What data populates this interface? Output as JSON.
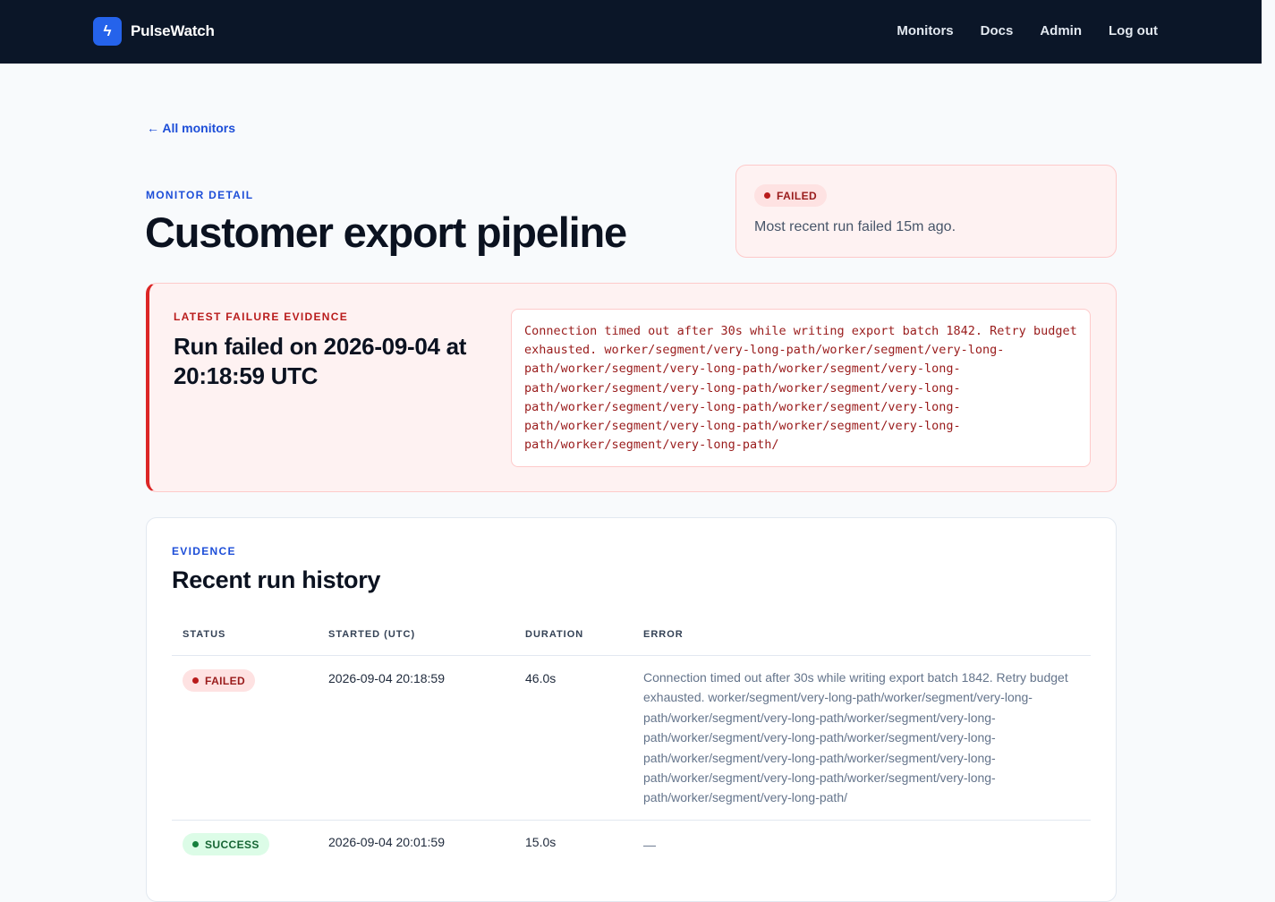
{
  "header": {
    "logo_glyph": "ϟ",
    "app_name": "PulseWatch",
    "nav": [
      "Monitors",
      "Docs",
      "Admin",
      "Log out"
    ]
  },
  "back_link": "← All monitors",
  "monitor": {
    "eyebrow": "MONITOR DETAIL",
    "title": "Customer export pipeline"
  },
  "status_card": {
    "badge": "FAILED",
    "text": "Most recent run failed 15m ago."
  },
  "evidence": {
    "eyebrow": "LATEST FAILURE EVIDENCE",
    "heading": "Run failed on 2026-09-04 at 20:18:59 UTC",
    "message": "Connection timed out after 30s while writing export batch 1842. Retry budget exhausted. worker/segment/very-long-path/worker/segment/very-long-path/worker/segment/very-long-path/worker/segment/very-long-path/worker/segment/very-long-path/worker/segment/very-long-path/worker/segment/very-long-path/worker/segment/very-long-path/worker/segment/very-long-path/worker/segment/very-long-path/worker/segment/very-long-path/"
  },
  "history": {
    "eyebrow": "EVIDENCE",
    "title": "Recent run history",
    "columns": [
      "STATUS",
      "STARTED (UTC)",
      "DURATION",
      "ERROR"
    ],
    "rows": [
      {
        "status": "FAILED",
        "started": "2026-09-04 20:18:59",
        "duration": "46.0s",
        "error": "Connection timed out after 30s while writing export batch 1842. Retry budget exhausted. worker/segment/very-long-path/worker/segment/very-long-path/worker/segment/very-long-path/worker/segment/very-long-path/worker/segment/very-long-path/worker/segment/very-long-path/worker/segment/very-long-path/worker/segment/very-long-path/worker/segment/very-long-path/worker/segment/very-long-path/worker/segment/very-long-path/"
      },
      {
        "status": "SUCCESS",
        "started": "2026-09-04 20:01:59",
        "duration": "15.0s",
        "error": "—"
      }
    ]
  },
  "colors": {
    "topbar": "#0b1628",
    "accent": "#2563eb",
    "danger": "#dc2626",
    "success": "#15803d"
  }
}
